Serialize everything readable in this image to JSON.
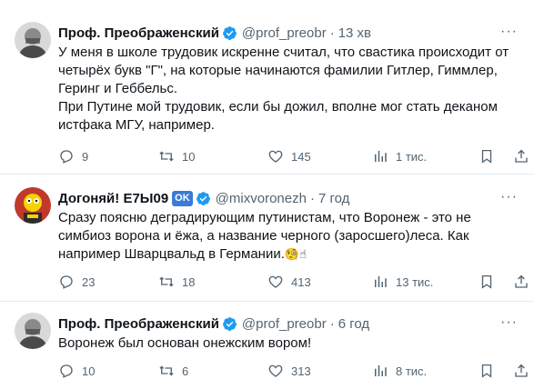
{
  "tweets": [
    {
      "name": "Проф. Преображенский",
      "handle": "@prof_preobr",
      "time": "13 хв",
      "text": [
        "У меня в школе трудовик искренне считал, что свастика происходит от четырёх букв \"Г\", на которые начинаются фамилии Гитлер, Гиммлер, Геринг и Геббельс.",
        "При Путине мой трудовик, если бы дожил, вполне мог стать деканом истфака МГУ, например."
      ],
      "replies": "9",
      "retweets": "10",
      "likes": "145",
      "views": "1 тис."
    },
    {
      "name": "Догоняй! Е7Ы09",
      "badge": "OK",
      "handle": "@mixvoronezh",
      "time": "7 год",
      "text": [
        "Сразу поясню деградирующим путинистам, что Воронеж - это не симбиоз ворона и ёжа, а название черного (заросшего)леса. Как например Шварцвальд в Германии."
      ],
      "emoji": "🧐☝",
      "replies": "23",
      "retweets": "18",
      "likes": "413",
      "views": "13 тис."
    },
    {
      "name": "Проф. Преображенский",
      "handle": "@prof_preobr",
      "time": "6 год",
      "text": [
        "Воронеж был основан онежским вором!"
      ],
      "replies": "10",
      "retweets": "6",
      "likes": "313",
      "views": "8 тис."
    }
  ],
  "separator": "·",
  "colors": {
    "verified": "#1d9bf0",
    "muted": "#536471",
    "text": "#0f1419",
    "divider": "#e6ecf0",
    "ok_badge": "#3a7bd5"
  },
  "icons": [
    "verified-badge-icon",
    "more-icon",
    "reply-icon",
    "retweet-icon",
    "like-icon",
    "views-icon",
    "bookmark-icon",
    "share-icon"
  ]
}
